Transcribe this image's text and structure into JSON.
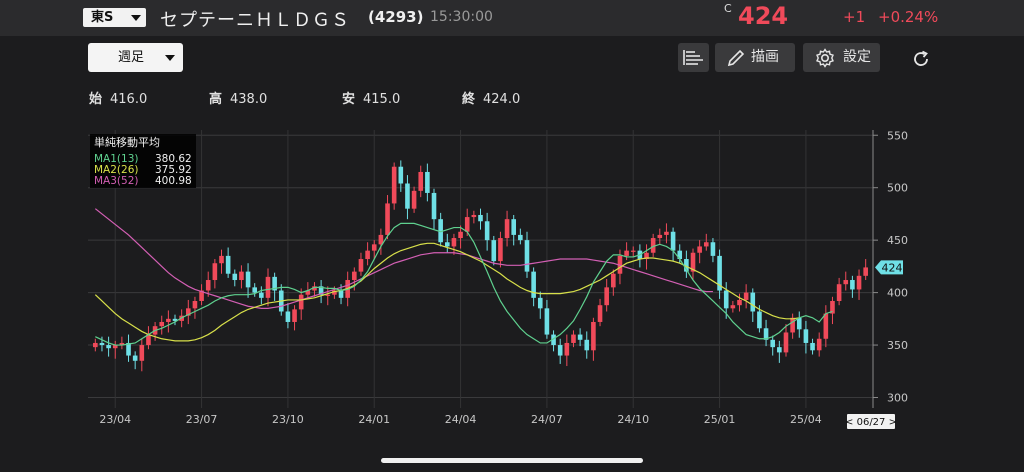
{
  "header": {
    "market": "東S",
    "stock_name": "セプテーニＨＬＤＧＳ",
    "code": "(4293)",
    "time": "15:30:00",
    "price_mark": "C",
    "price": "424",
    "change": "+1",
    "change_pct": "+0.24%",
    "up_color": "#f04a5a"
  },
  "toolbar": {
    "period": "週足",
    "draw_label": "描画",
    "settings_label": "設定"
  },
  "ohlc": {
    "open_label": "始",
    "open": "416.0",
    "high_label": "高",
    "high": "438.0",
    "low_label": "安",
    "low": "415.0",
    "close_label": "終",
    "close": "424.0"
  },
  "legend": {
    "title": "単純移動平均",
    "items": [
      {
        "name": "MA1(13)",
        "value": "380.62",
        "color": "#5fd18f"
      },
      {
        "name": "MA2(26)",
        "value": "375.92",
        "color": "#d8e04a"
      },
      {
        "name": "MA3(52)",
        "value": "400.98",
        "color": "#d35fb4"
      }
    ]
  },
  "chart_data": {
    "type": "candlestick",
    "x_ticks": [
      "23/04",
      "23/07",
      "23/10",
      "24/01",
      "24/04",
      "24/07",
      "24/10",
      "25/01",
      "25/04"
    ],
    "y_ticks": [
      "550",
      "500",
      "450",
      "400",
      "350",
      "300"
    ],
    "ylim": [
      290,
      555
    ],
    "current_price_label": "424",
    "cursor_label": "< 06/27 >",
    "up_color": "#f04a5a",
    "down_color": "#6fe0e6",
    "closes": [
      352,
      350,
      347,
      350,
      352,
      340,
      335,
      350,
      360,
      368,
      372,
      375,
      373,
      378,
      385,
      392,
      402,
      412,
      428,
      435,
      418,
      412,
      420,
      405,
      400,
      395,
      415,
      402,
      382,
      372,
      384,
      398,
      402,
      406,
      398,
      398,
      402,
      395,
      412,
      420,
      432,
      440,
      446,
      455,
      485,
      520,
      504,
      480,
      497,
      515,
      495,
      470,
      448,
      444,
      452,
      458,
      472,
      474,
      468,
      450,
      430,
      452,
      470,
      455,
      450,
      420,
      395,
      385,
      360,
      350,
      340,
      352,
      360,
      355,
      345,
      372,
      388,
      405,
      418,
      435,
      440,
      440,
      432,
      438,
      452,
      455,
      458,
      440,
      432,
      420,
      438,
      444,
      448,
      435,
      402,
      385,
      388,
      393,
      400,
      382,
      366,
      355,
      348,
      343,
      362,
      376,
      365,
      352,
      345,
      356,
      380,
      392,
      408,
      412,
      403,
      416,
      424
    ],
    "ma1": [
      358,
      355,
      352,
      350,
      350,
      351,
      352,
      356,
      360,
      364,
      366,
      369,
      372,
      376,
      379,
      382,
      385,
      388,
      392,
      395,
      397,
      398,
      398,
      398,
      399,
      402,
      403,
      404,
      405,
      405,
      403,
      400,
      402,
      405,
      405,
      404,
      404,
      402,
      403,
      406,
      412,
      420,
      432,
      444,
      454,
      462,
      466,
      466,
      466,
      464,
      462,
      460,
      458,
      460,
      462,
      462,
      458,
      448,
      434,
      420,
      405,
      392,
      382,
      374,
      366,
      360,
      356,
      352,
      352,
      356,
      360,
      366,
      373,
      384,
      396,
      410,
      420,
      430,
      436,
      436,
      434,
      434,
      436,
      440,
      444,
      446,
      444,
      440,
      432,
      422,
      412,
      404,
      398,
      392,
      386,
      380,
      372,
      366,
      360,
      358,
      356,
      356,
      358,
      362,
      368,
      372,
      376,
      378,
      376,
      372,
      380,
      382
    ],
    "ma2": [
      398,
      392,
      386,
      380,
      375,
      371,
      367,
      363,
      360,
      358,
      356,
      355,
      354,
      354,
      354,
      355,
      357,
      360,
      364,
      369,
      373,
      377,
      381,
      384,
      386,
      388,
      390,
      391,
      392,
      393,
      393,
      393,
      394,
      395,
      397,
      399,
      401,
      402,
      404,
      407,
      411,
      417,
      423,
      428,
      433,
      437,
      440,
      442,
      444,
      446,
      447,
      447,
      445,
      443,
      441,
      439,
      436,
      433,
      430,
      426,
      422,
      418,
      413,
      409,
      405,
      402,
      400,
      399,
      399,
      399,
      399,
      400,
      401,
      403,
      406,
      409,
      412,
      416,
      420,
      424,
      428,
      430,
      432,
      433,
      433,
      432,
      431,
      430,
      428,
      425,
      422,
      419,
      415,
      411,
      407,
      403,
      399,
      395,
      392,
      388,
      384,
      381,
      378,
      376,
      375,
      375,
      376
    ],
    "ma3": [
      480,
      475,
      470,
      465,
      460,
      455,
      449,
      443,
      437,
      431,
      425,
      419,
      414,
      410,
      406,
      403,
      401,
      399,
      397,
      395,
      393,
      391,
      389,
      387,
      386,
      385,
      385,
      386,
      387,
      389,
      391,
      393,
      395,
      397,
      399,
      401,
      403,
      405,
      407,
      410,
      413,
      416,
      419,
      422,
      425,
      428,
      430,
      432,
      434,
      436,
      437,
      438,
      438,
      438,
      438,
      437,
      436,
      434,
      432,
      430,
      428,
      427,
      426,
      426,
      426,
      427,
      428,
      429,
      430,
      431,
      432,
      432,
      432,
      432,
      432,
      431,
      430,
      429,
      428,
      426,
      424,
      422,
      420,
      418,
      416,
      414,
      412,
      410,
      408,
      406,
      404,
      402,
      401,
      401
    ]
  }
}
